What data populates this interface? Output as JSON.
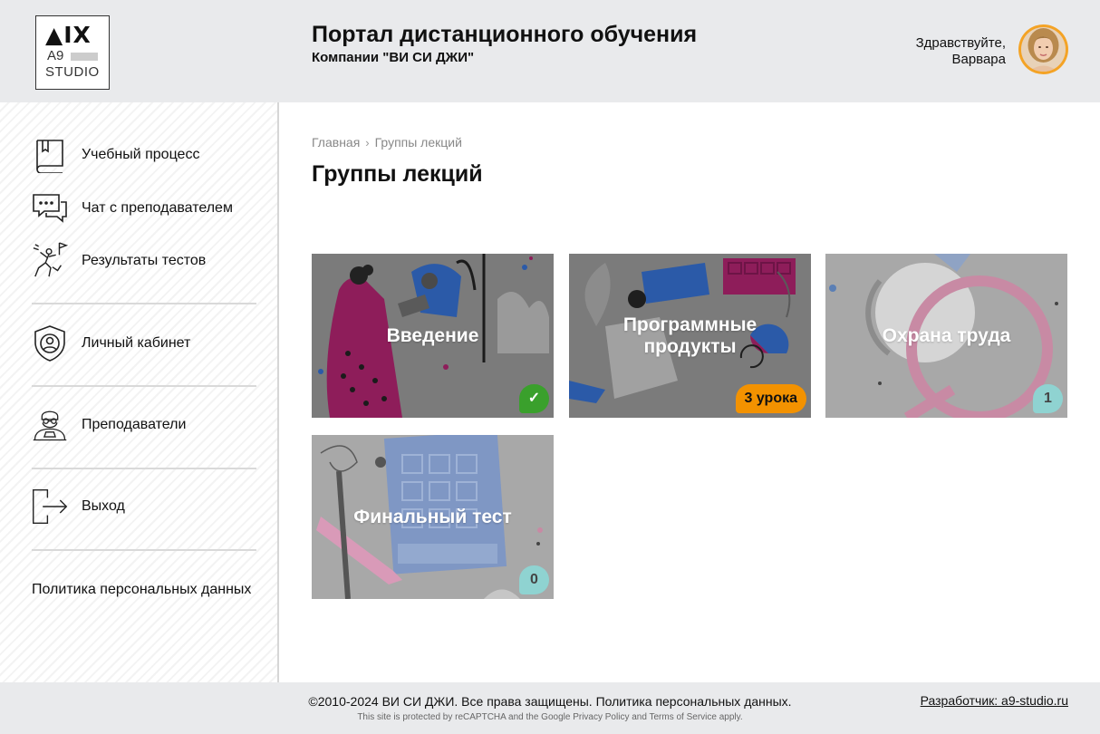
{
  "header": {
    "logo_top": "▲IX",
    "logo_a9": "A9",
    "logo_studio": "STUDIO",
    "title": "Портал дистанционного обучения",
    "subtitle": "Компании \"ВИ СИ ДЖИ\"",
    "greeting_line1": "Здравствуйте,",
    "greeting_line2": "Варвара"
  },
  "sidebar": {
    "items": [
      {
        "label": "Учебный процесс",
        "icon": "book-icon"
      },
      {
        "label": "Чат с преподавателем",
        "icon": "chat-icon"
      },
      {
        "label": "Результаты тестов",
        "icon": "climber-icon"
      },
      {
        "label": "Личный кабинет",
        "icon": "shield-user-icon"
      },
      {
        "label": "Преподаватели",
        "icon": "teacher-icon"
      },
      {
        "label": "Выход",
        "icon": "logout-icon"
      }
    ],
    "policy": "Политика персональных данных"
  },
  "main": {
    "breadcrumb": [
      "Главная",
      "Группы лекций"
    ],
    "title": "Группы лекций",
    "cards": [
      {
        "title": "Введение",
        "badge": "✓",
        "badge_type": "done"
      },
      {
        "title": "Программные продукты",
        "badge": "3 урока",
        "badge_type": "orange"
      },
      {
        "title": "Охрана труда",
        "badge": "1",
        "badge_type": "teal"
      },
      {
        "title": "Финальный тест",
        "badge": "0",
        "badge_type": "teal"
      }
    ]
  },
  "footer": {
    "copyright": "©2010-2024 ВИ СИ ДЖИ. Все права защищены. Политика персональных данных.",
    "recaptcha": "This site is protected by reCAPTCHA and the Google Privacy Policy and Terms of Service apply.",
    "developer": "Разработчик: a9-studio.ru"
  },
  "colors": {
    "header_bg": "#e9eaec",
    "accent_orange": "#f39200",
    "success_green": "#3aa02c",
    "teal_badge": "#8fd3d1",
    "magenta": "#b0236e",
    "blue": "#2a5fb0"
  }
}
